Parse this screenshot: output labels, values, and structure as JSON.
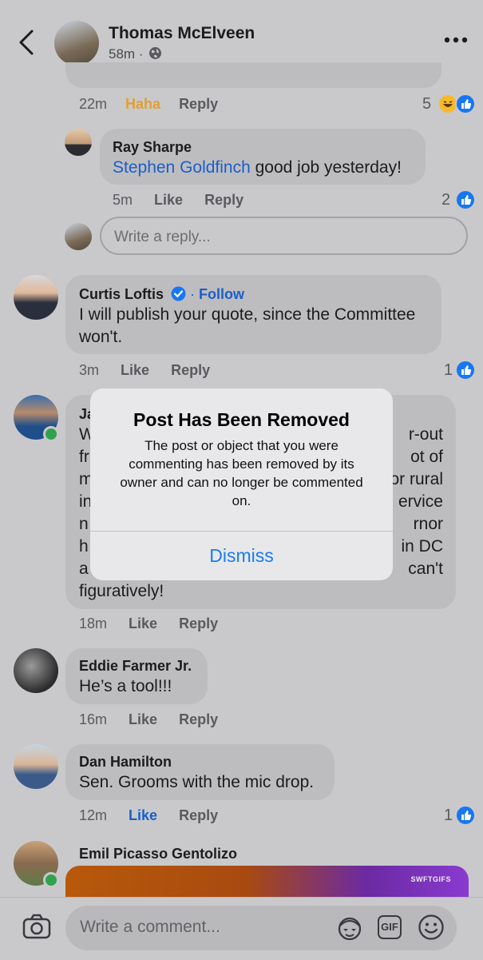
{
  "header": {
    "name": "Thomas McElveen",
    "meta": "58m ·"
  },
  "top_comment": {
    "time": "22m",
    "reaction_label": "Haha",
    "reply_label": "Reply",
    "reaction_count": "5"
  },
  "ray": {
    "name": "Ray Sharpe",
    "mention": "Stephen Goldfinch",
    "text": " good job yesterday!",
    "time": "5m",
    "like_label": "Like",
    "reply_label": "Reply",
    "reaction_count": "2"
  },
  "reply_input": {
    "placeholder": "Write a reply..."
  },
  "curtis": {
    "name": "Curtis Loftis",
    "follow": "Follow",
    "line1": "I will publish your quote, since the Committee",
    "line2": "won't.",
    "time": "3m",
    "like_label": "Like",
    "reply_label": "Reply",
    "reaction_count": "1"
  },
  "hidden_comment": {
    "name_fragment": "Ja",
    "left": [
      "W",
      "fr",
      "m",
      "in",
      "n",
      "h",
      "a"
    ],
    "right": [
      "r-out",
      "ot of",
      "or rural",
      "ervice",
      "rnor",
      "in DC",
      "can't"
    ],
    "last": "figuratively!",
    "time": "18m",
    "like_label": "Like",
    "reply_label": "Reply"
  },
  "eddie": {
    "name": "Eddie Farmer Jr.",
    "text": "He’s a tool!!!",
    "time": "16m",
    "like_label": "Like",
    "reply_label": "Reply"
  },
  "dan": {
    "name": "Dan Hamilton",
    "text": "Sen. Grooms with the mic drop.",
    "time": "12m",
    "like_label": "Like",
    "reply_label": "Reply",
    "reaction_count": "1"
  },
  "emil": {
    "name": "Emil Picasso Gentolizo",
    "gif_tag": "SWFTGIFS"
  },
  "modal": {
    "title": "Post Has Been Removed",
    "body": "The post or object that you were commenting has been removed by its owner and can no longer be commented on.",
    "button": "Dismiss"
  },
  "composer": {
    "placeholder": "Write a comment...",
    "gif_label": "GIF"
  },
  "colors": {
    "background": "#c9c9cb",
    "bubble": "#bdbdc0",
    "link": "#1b5ec9",
    "like_blue": "#1877f2",
    "haha_orange": "#e0a030",
    "online_green": "#31a24c"
  },
  "icons": [
    "chevron-left-icon",
    "globe-icon",
    "more-icon",
    "like-icon",
    "haha-icon",
    "verified-icon",
    "camera-icon",
    "avatar-sticker-icon",
    "gif-icon",
    "emoji-icon"
  ]
}
